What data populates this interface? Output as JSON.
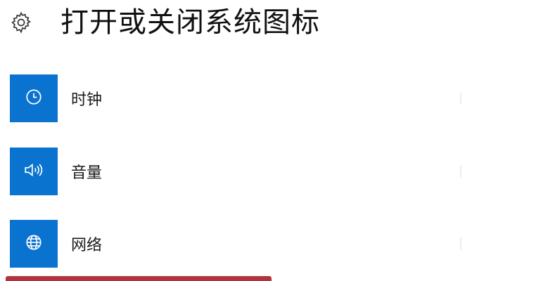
{
  "header": {
    "title": "打开或关闭系统图标",
    "icon": "gear-icon"
  },
  "items": [
    {
      "label": "时钟",
      "icon": "clock-icon"
    },
    {
      "label": "音量",
      "icon": "volume-icon"
    },
    {
      "label": "网络",
      "icon": "globe-icon"
    }
  ],
  "colors": {
    "tile": "#0a73cf",
    "highlight_border": "#b2333b"
  }
}
